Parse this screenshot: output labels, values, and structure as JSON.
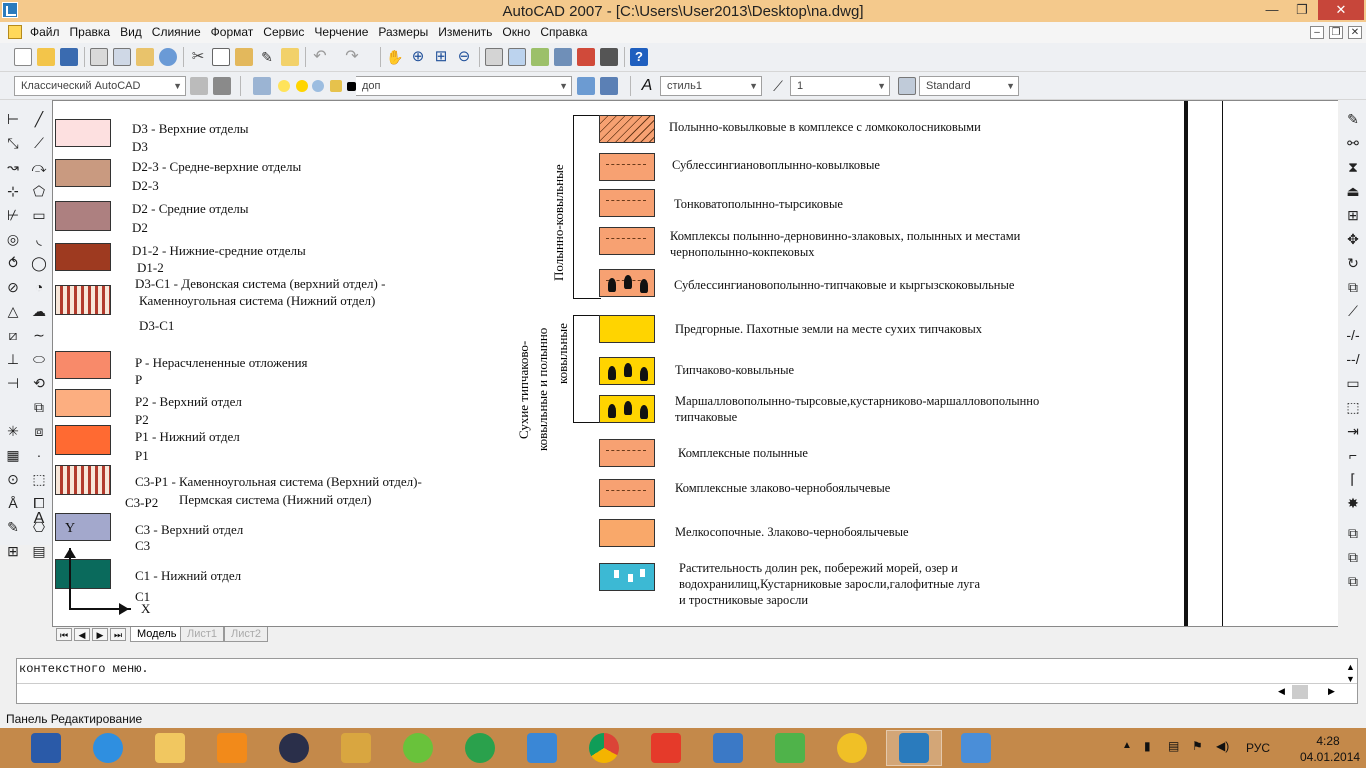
{
  "window": {
    "title": "AutoCAD 2007 - [C:\\Users\\User2013\\Desktop\\na.dwg]"
  },
  "menu": [
    "Файл",
    "Правка",
    "Вид",
    "Слияние",
    "Формат",
    "Сервис",
    "Черчение",
    "Размеры",
    "Изменить",
    "Окно",
    "Справка"
  ],
  "toolbar": {
    "workspace": "Классический AutoCAD",
    "layer": "доп",
    "text_style": "стиль1",
    "dim_style": "1",
    "table_style": "Standard",
    "help_label": "?"
  },
  "legend_left": [
    {
      "label": "D3 -  Верхние отделы",
      "code": "D3",
      "color": "#fde0e0"
    },
    {
      "label": "D2-3 - Средне-верхние отделы",
      "code": "D2-3",
      "color": "#c99a80"
    },
    {
      "label": "D2 - Средние отделы",
      "code": "D2",
      "color": "#ad8080"
    },
    {
      "label": "D1-2 - Нижние-средние отделы",
      "code": "D1-2",
      "color": "#9e3a20"
    },
    {
      "label": "D3-C1 - Девонская система (верхний отдел) -",
      "label2": "Каменноугольная система (Нижний отдел)",
      "code": "D3-C1",
      "color": "stripes"
    },
    {
      "label": "P - Нерасчлененные отложения",
      "code": "P",
      "color": "#f88a6a"
    },
    {
      "label": "P2 - Верхний отдел",
      "code": "P2",
      "color": "#fcae80"
    },
    {
      "label": "P1 - Нижний отдел",
      "code": "P1",
      "color": "#ff6a32"
    },
    {
      "label": "C3-P1 - Каменноугольная система (Верхний отдел)-",
      "label2": "Пермская система (Нижний отдел)",
      "code": "C3-P2",
      "color": "stripes"
    },
    {
      "label": "C3 - Верхний отдел",
      "code": "C3",
      "color": "#a3a8cc"
    },
    {
      "label": "C1 - Нижний отдел",
      "code": "C1",
      "color": "#0a6a5c"
    }
  ],
  "ucs": {
    "x_label": "X"
  },
  "vertical_labels": {
    "group1": "Полынно-ковыльные",
    "group2a": "Сухие типчаково-",
    "group2b": "ковыльные и полынно",
    "group2c": "ковыльные"
  },
  "legend_right": [
    {
      "label": "Полынно-ковылковые в комплексе с ломкоколосниковыми",
      "fill": "hatch"
    },
    {
      "label": "Сублессингиановоплынно-ковылковые",
      "fill": "#f7a172"
    },
    {
      "label": "Тонковатополынно-тырсиковые",
      "fill": "#f7a172"
    },
    {
      "label": "Комплексы полынно-дерновинно-злаковых, полынных и местами",
      "label2": "чернополынно-кокпековых",
      "fill": "#f7a172"
    },
    {
      "label": "Сублессингиановополынно-типчаковые и кыргызскоковыльные",
      "fill": "#f7a172"
    },
    {
      "label": "Предгорные. Пахотные земли на месте сухих типчаковых",
      "fill": "#ffd400"
    },
    {
      "label": "Типчаково-ковыльные",
      "fill": "#ffd400"
    },
    {
      "label": "Маршалловополынно-тырсовые,кустарниково-маршалловополынно",
      "label2": "типчаковые",
      "fill": "#ffd400"
    },
    {
      "label": "Комплексные полынные",
      "fill": "#f7a172"
    },
    {
      "label": "Комплексные злаково-чернобоялычевые",
      "fill": "#f7a172"
    },
    {
      "label": "Мелкосопочные. Злаково-чернобоялычевые",
      "fill": "#f9a86a"
    },
    {
      "label": "Растительность долин рек, побережий морей, озер и",
      "label2": "водохранилищ,Кустарниковые заросли,галофитные луга",
      "label3": " и тростниковые заросли",
      "fill": "#3cb9d4"
    }
  ],
  "tabs": [
    "Модель",
    "Лист1",
    "Лист2"
  ],
  "command": {
    "text": "контекстного меню."
  },
  "status": {
    "text": "Панель Редактирование"
  },
  "tray": {
    "lang": "РУС",
    "time": "4:28",
    "date": "04.01.2014"
  }
}
